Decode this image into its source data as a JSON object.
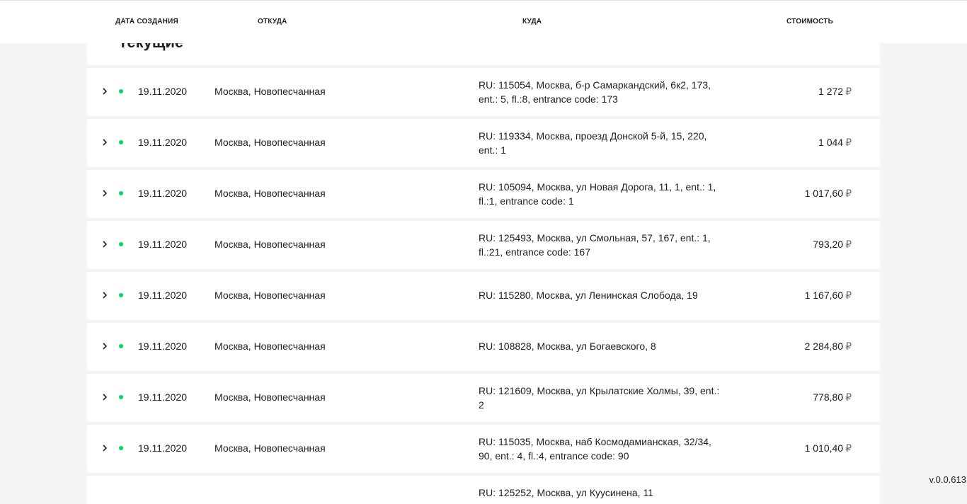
{
  "header": {
    "date": "ДАТА СОЗДАНИЯ",
    "from": "ОТКУДА",
    "to": "КУДА",
    "cost": "СТОИМОСТЬ"
  },
  "section": {
    "title": "Текущие"
  },
  "rows": [
    {
      "date": "19.11.2020",
      "from": "Москва, Новопесчанная",
      "to": "RU: 115054, Москва, б-р Самаркандский, 6к2, 173, ent.: 5, fl.:8, entrance code: 173",
      "cost": "1 272",
      "currency": "₽"
    },
    {
      "date": "19.11.2020",
      "from": "Москва, Новопесчанная",
      "to": "RU: 119334, Москва, проезд Донской 5-й, 15, 220, ent.: 1",
      "cost": "1 044",
      "currency": "₽"
    },
    {
      "date": "19.11.2020",
      "from": "Москва, Новопесчанная",
      "to": "RU: 105094, Москва, ул Новая Дорога, 11, 1, ent.: 1, fl.:1, entrance code: 1",
      "cost": "1 017,60",
      "currency": "₽"
    },
    {
      "date": "19.11.2020",
      "from": "Москва, Новопесчанная",
      "to": "RU: 125493, Москва, ул Смольная, 57, 167, ent.: 1, fl.:21, entrance code: 167",
      "cost": "793,20",
      "currency": "₽"
    },
    {
      "date": "19.11.2020",
      "from": "Москва, Новопесчанная",
      "to": "RU: 115280, Москва, ул Ленинская Слобода, 19",
      "cost": "1 167,60",
      "currency": "₽"
    },
    {
      "date": "19.11.2020",
      "from": "Москва, Новопесчанная",
      "to": "RU: 108828, Москва, ул Богаевского, 8",
      "cost": "2 284,80",
      "currency": "₽"
    },
    {
      "date": "19.11.2020",
      "from": "Москва, Новопесчанная",
      "to": "RU: 121609, Москва, ул Крылатские Холмы, 39, ent.: 2",
      "cost": "778,80",
      "currency": "₽"
    },
    {
      "date": "19.11.2020",
      "from": "Москва, Новопесчанная",
      "to": "RU: 115035, Москва, наб Космодамианская, 32/34, 90, ent.: 4, fl.:4, entrance code: 90",
      "cost": "1 010,40",
      "currency": "₽"
    },
    {
      "date": "",
      "from": "",
      "to": "RU: 125252, Москва, ул Куусинена, 11",
      "cost": "",
      "currency": ""
    }
  ],
  "icons": {
    "expand": "chevron-right-icon",
    "status": "status-dot-icon"
  },
  "colors": {
    "status_active": "#00d95f",
    "background": "#f5f4f2",
    "card": "#ffffff"
  },
  "footer": {
    "version": "v.0.0.613"
  }
}
